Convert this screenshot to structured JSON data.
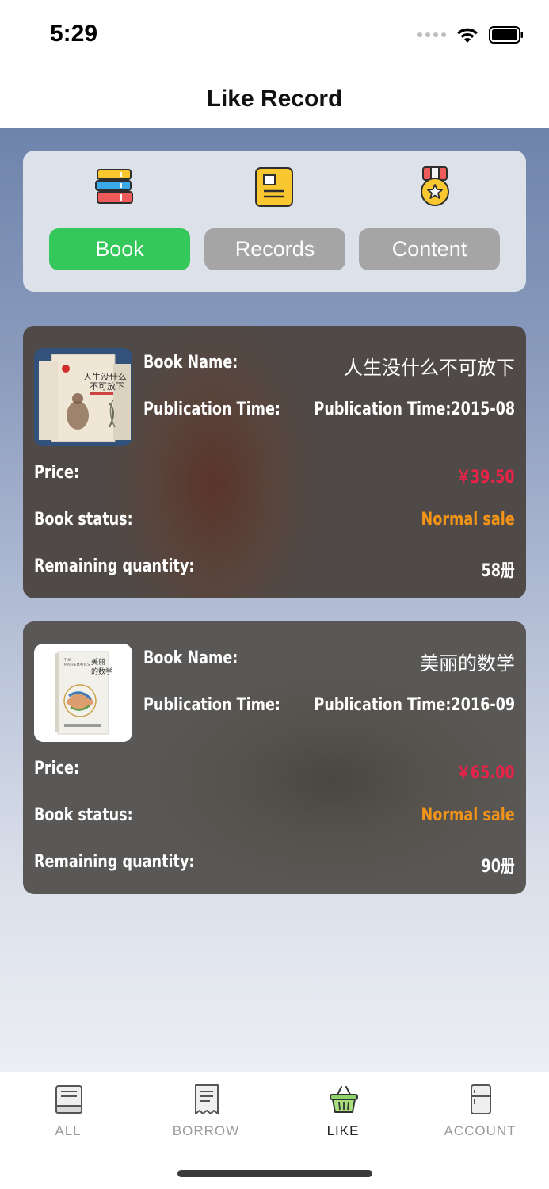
{
  "status_bar": {
    "time": "5:29"
  },
  "nav": {
    "title": "Like Record"
  },
  "categories": [
    {
      "label": "Book",
      "icon": "books-icon",
      "color": "#34c759",
      "active": true
    },
    {
      "label": "Records",
      "icon": "notepad-icon",
      "color": "#a5a5a5",
      "active": false
    },
    {
      "label": "Content",
      "icon": "medal-icon",
      "color": "#a5a5a5",
      "active": false
    }
  ],
  "books": [
    {
      "name_label": "Book Name:",
      "name": "人生没什么不可放下",
      "pub_label": "Publication Time:",
      "pub_time": "Publication Time:2015-08",
      "price_label": "Price:",
      "price": "￥39.50",
      "status_label": "Book status:",
      "status": "Normal sale",
      "qty_label": "Remaining quantity:",
      "qty": "58册",
      "cover_title": "人生没什么不可放下"
    },
    {
      "name_label": "Book Name:",
      "name": "美丽的数学",
      "pub_label": "Publication Time:",
      "pub_time": "Publication Time:2016-09",
      "price_label": "Price:",
      "price": "￥65.00",
      "status_label": "Book status:",
      "status": "Normal sale",
      "qty_label": "Remaining quantity:",
      "qty": "90册",
      "cover_title": "美丽的数学"
    }
  ],
  "tabs": [
    {
      "label": "ALL",
      "icon": "book-icon",
      "active": false
    },
    {
      "label": "BORROW",
      "icon": "receipt-icon",
      "active": false
    },
    {
      "label": "LIKE",
      "icon": "basket-icon",
      "active": true
    },
    {
      "label": "ACCOUNT",
      "icon": "fridge-icon",
      "active": false
    }
  ],
  "colors": {
    "accent": "#34c759",
    "inactive_button": "#a5a5a5",
    "price": "#e8234a",
    "status": "#f39418"
  }
}
